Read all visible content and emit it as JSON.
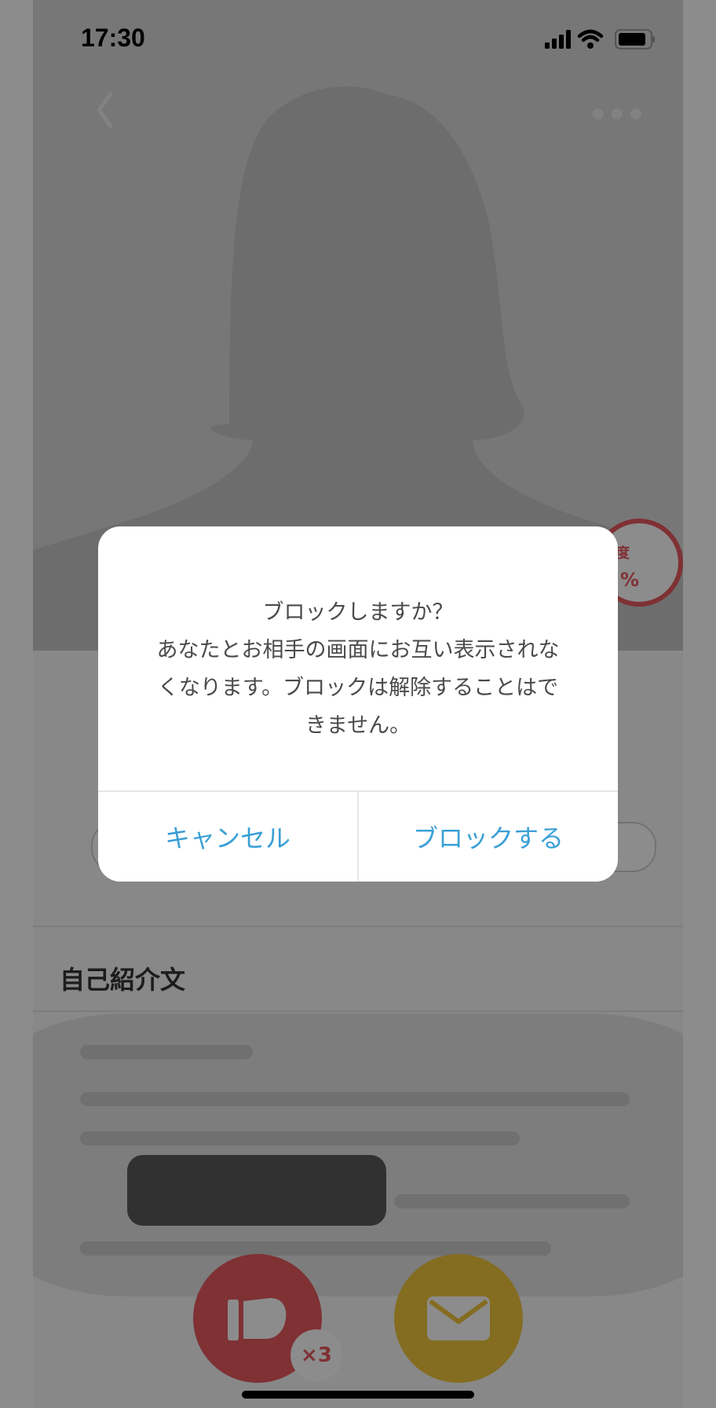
{
  "status_bar": {
    "time": "17:30",
    "icons": [
      "signal-icon",
      "wifi-icon",
      "battery-icon"
    ]
  },
  "profile": {
    "match_label": "度",
    "match_value": "%",
    "section_title": "自己紹介文",
    "like_count": "×3"
  },
  "dialog": {
    "message_lines": [
      "ブロックしますか？",
      "あなたとお相手の画面にお互い表示されな",
      "くなります。ブロックは解除することはで",
      "きません。"
    ],
    "cancel_label": "キャンセル",
    "confirm_label": "ブロックする"
  },
  "colors": {
    "accent": "#3a9fd6",
    "like": "#e85a5f",
    "message": "#f0c73c",
    "overlay": "rgba(0,0,0,0.45)"
  }
}
